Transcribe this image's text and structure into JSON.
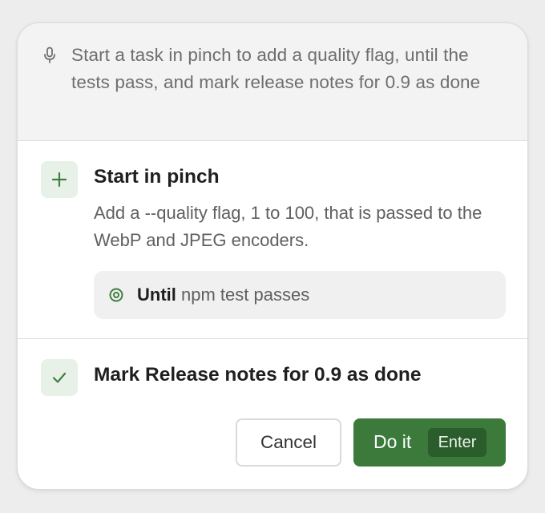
{
  "prompt": {
    "text": "Start a task in pinch to add a quality flag, until the tests pass, and mark release notes for 0.9 as done",
    "icon": "microphone-icon"
  },
  "actions": [
    {
      "icon": "plus-icon",
      "title": "Start in pinch",
      "description": "Add a --quality flag, 1 to 100, that is passed to the WebP and JPEG encoders.",
      "condition": {
        "icon": "target-icon",
        "keyword": "Until",
        "text": "npm test passes"
      }
    },
    {
      "icon": "check-icon",
      "title": "Mark Release notes for 0.9 as done"
    }
  ],
  "buttons": {
    "cancel_label": "Cancel",
    "confirm_label": "Do it",
    "confirm_shortcut": "Enter"
  },
  "colors": {
    "accent": "#3b7a3b",
    "badge_bg": "#e8f1e7",
    "icon_green": "#3f7f3f"
  }
}
